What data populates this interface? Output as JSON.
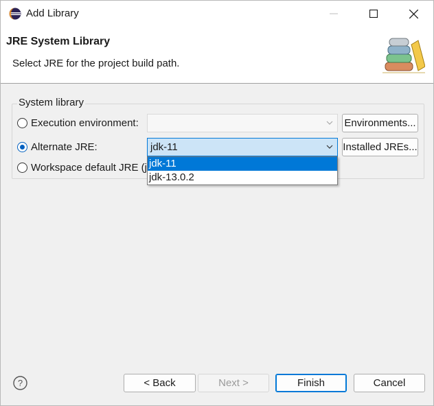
{
  "window": {
    "title": "Add Library"
  },
  "banner": {
    "title": "JRE System Library",
    "description": "Select JRE for the project build path."
  },
  "group": {
    "label": "System library",
    "exec_env_label": "Execution environment:",
    "exec_env_value": "",
    "environments_button": "Environments...",
    "alt_jre_label": "Alternate JRE:",
    "alt_jre_value": "jdk-11",
    "installed_jres_button": "Installed JREs...",
    "workspace_label": "Workspace default JRE (j",
    "selected_option": "Alternate JRE:"
  },
  "dropdown": {
    "options": [
      "jdk-11",
      "jdk-13.0.2"
    ],
    "selected": "jdk-11"
  },
  "footer": {
    "back": "< Back",
    "next": "Next >",
    "finish": "Finish",
    "cancel": "Cancel"
  },
  "colors": {
    "accent": "#0078d7",
    "selection": "#cce4f7"
  },
  "icons": [
    "eclipse-icon",
    "minimize-icon",
    "maximize-icon",
    "close-icon",
    "library-books-icon",
    "chevron-down-icon",
    "help-icon"
  ]
}
